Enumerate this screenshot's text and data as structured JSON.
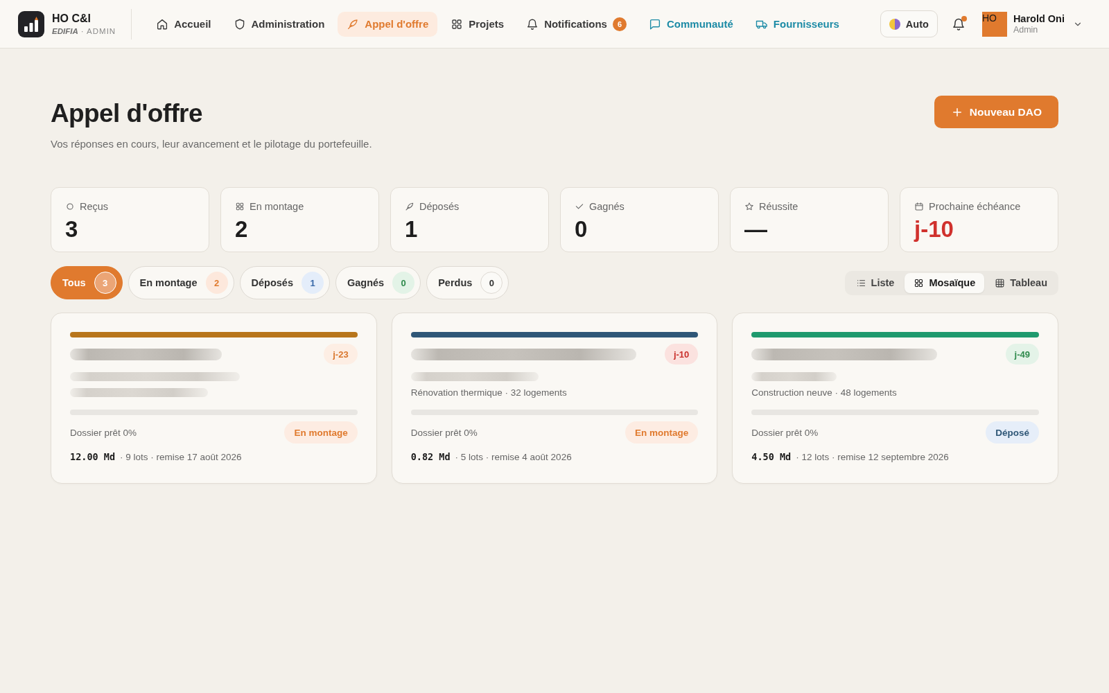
{
  "app": {
    "name": "HO C&I",
    "brand": "EDIFIA",
    "role": "· ADMIN"
  },
  "nav": [
    {
      "label": "Accueil",
      "selected": false,
      "kind": "page"
    },
    {
      "label": "Administration",
      "selected": false,
      "kind": "page"
    },
    {
      "label": "Appel d'offre",
      "selected": true,
      "kind": "page"
    },
    {
      "label": "Projets",
      "selected": false,
      "kind": "page"
    },
    {
      "label": "Notifications",
      "selected": false,
      "kind": "page",
      "badge": "6"
    },
    {
      "label": "Communauté",
      "selected": false,
      "kind": "link"
    },
    {
      "label": "Fournisseurs",
      "selected": false,
      "kind": "link"
    }
  ],
  "theme_button": {
    "label": "Auto"
  },
  "notifications": {
    "unread": true
  },
  "user": {
    "initials": "HO",
    "name": "Harold Oni",
    "role": "Admin"
  },
  "page": {
    "title": "Appel d'offre",
    "subtitle": "Vos réponses en cours, leur avancement et le pilotage du portefeuille.",
    "primary_action": "Nouveau DAO"
  },
  "stats": [
    {
      "label": "Reçus",
      "value": "3",
      "kind": "plain"
    },
    {
      "label": "En montage",
      "value": "2",
      "kind": "plain"
    },
    {
      "label": "Déposés",
      "value": "1",
      "kind": "plain"
    },
    {
      "label": "Gagnés",
      "value": "0",
      "kind": "plain"
    },
    {
      "label": "Réussite",
      "value": "—",
      "kind": "plain"
    },
    {
      "label": "Prochaine échéance",
      "value": "j-10",
      "kind": "alert"
    }
  ],
  "filters": [
    {
      "label": "Tous",
      "count": "3",
      "selected": true,
      "kind": "all"
    },
    {
      "label": "En montage",
      "count": "2",
      "selected": false,
      "kind": "montage"
    },
    {
      "label": "Déposés",
      "count": "1",
      "selected": false,
      "kind": "depose"
    },
    {
      "label": "Gagnés",
      "count": "0",
      "selected": false,
      "kind": "gagne"
    },
    {
      "label": "Perdus",
      "count": "0",
      "selected": false,
      "kind": "perdu"
    }
  ],
  "views": [
    {
      "label": "Liste",
      "selected": false
    },
    {
      "label": "Mosaïque",
      "selected": true
    },
    {
      "label": "Tableau",
      "selected": false
    }
  ],
  "cards": [
    {
      "color": "#b8761c",
      "title": {
        "kind": "blurred"
      },
      "deadline": {
        "text": "j-23",
        "kind": "soon"
      },
      "details": [
        {
          "kind": "blurred"
        },
        {
          "kind": "blurred"
        }
      ],
      "progress": {
        "label": "Dossier prêt 0%"
      },
      "status": {
        "label": "En montage",
        "kind": "montage"
      },
      "amount": "12.00 Md",
      "meta": "· 9 lots · remise 17 août 2026"
    },
    {
      "color": "#2f5777",
      "title": {
        "kind": "blurred"
      },
      "deadline": {
        "text": "j-10",
        "kind": "urgent"
      },
      "details": [
        {
          "kind": "blurred"
        },
        {
          "kind": "text",
          "text": "Rénovation thermique · 32 logements"
        }
      ],
      "progress": {
        "label": "Dossier prêt 0%"
      },
      "status": {
        "label": "En montage",
        "kind": "montage"
      },
      "amount": "0.82 Md",
      "meta": "· 5 lots · remise 4 août 2026"
    },
    {
      "color": "#1f9a6e",
      "title": {
        "kind": "blurred"
      },
      "deadline": {
        "text": "j-49",
        "kind": "later"
      },
      "details": [
        {
          "kind": "blurred"
        },
        {
          "kind": "text",
          "text": "Construction neuve · 48 logements"
        }
      ],
      "progress": {
        "label": "Dossier prêt 0%"
      },
      "status": {
        "label": "Déposé",
        "kind": "depose"
      },
      "amount": "4.50 Md",
      "meta": "· 12 lots · remise 12 septembre 2026"
    }
  ]
}
